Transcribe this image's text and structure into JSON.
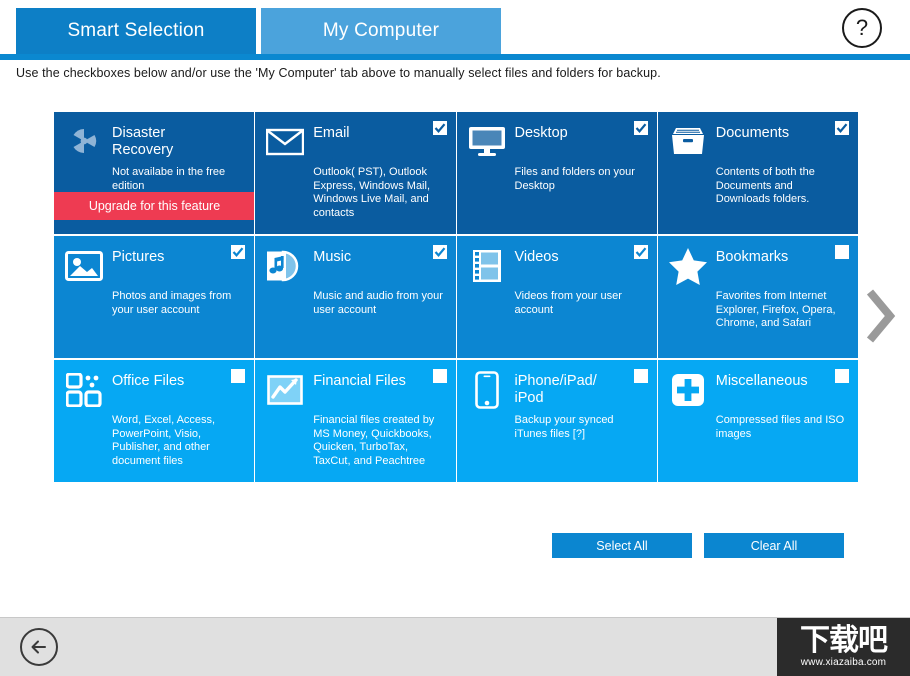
{
  "tabs": [
    {
      "label": "Smart Selection",
      "active": true
    },
    {
      "label": "My Computer",
      "active": false
    }
  ],
  "help": {
    "icon": "question-mark-icon",
    "label": "?"
  },
  "instruction": "Use the checkboxes below and/or use the 'My Computer' tab above to manually select files and folders for backup.",
  "colors": {
    "tab_active": "#0d7fc6",
    "tab_inactive": "#4ba3dc",
    "underline": "#0b88d0",
    "row1_tile": "#0a5ca0",
    "row2_tile": "#0c86d2",
    "row3_tile": "#06a8f3",
    "upgrade_banner": "#ee3b52",
    "button": "#0b86d0",
    "footer": "#e0e0e0",
    "watermark_bg": "#2b2b2b"
  },
  "grid": {
    "rows": [
      {
        "tiles": [
          {
            "title": "Disaster Recovery",
            "desc": "Not availabe in the free edition",
            "icon": "radiation-icon",
            "checkbox": "none",
            "banner": "Upgrade for this feature"
          },
          {
            "title": "Email",
            "desc": "Outlook( PST), Outlook Express, Windows Mail, Windows Live Mail, and contacts",
            "icon": "envelope-icon",
            "checkbox": "checked"
          },
          {
            "title": "Desktop",
            "desc": "Files and folders on your Desktop",
            "icon": "monitor-icon",
            "checkbox": "checked"
          },
          {
            "title": "Documents",
            "desc": "Contents of both the Documents and Downloads folders.",
            "icon": "file-box-icon",
            "checkbox": "checked"
          }
        ]
      },
      {
        "tiles": [
          {
            "title": "Pictures",
            "desc": "Photos and images from your user account",
            "icon": "picture-icon",
            "checkbox": "checked"
          },
          {
            "title": "Music",
            "desc": "Music and audio from your user account",
            "icon": "music-note-icon",
            "checkbox": "checked"
          },
          {
            "title": "Videos",
            "desc": "Videos from your user account",
            "icon": "film-strip-icon",
            "checkbox": "checked"
          },
          {
            "title": "Bookmarks",
            "desc": "Favorites from Internet Explorer, Firefox, Opera, Chrome, and Safari",
            "icon": "star-icon",
            "checkbox": "unchecked"
          }
        ]
      },
      {
        "tiles": [
          {
            "title": "Office Files",
            "desc": "Word, Excel, Access, PowerPoint, Visio, Publisher, and other document files",
            "icon": "office-icon",
            "checkbox": "unchecked"
          },
          {
            "title": "Financial Files",
            "desc": "Financial files created by MS Money, Quickbooks, Quicken, TurboTax, TaxCut, and Peachtree",
            "icon": "chart-line-icon",
            "checkbox": "unchecked"
          },
          {
            "title": "iPhone/iPad/ iPod",
            "desc": "Backup your synced iTunes files [?]",
            "icon": "smartphone-icon",
            "checkbox": "unchecked"
          },
          {
            "title": "Miscellaneous",
            "desc": "Compressed files and ISO images",
            "icon": "plus-box-icon",
            "checkbox": "unchecked"
          }
        ]
      }
    ]
  },
  "next_page": {
    "icon": "chevron-right-icon"
  },
  "actions": {
    "select_all": "Select All",
    "clear_all": "Clear All"
  },
  "footer": {
    "back_icon": "arrow-left-circle-icon",
    "watermark_cn": "下载吧",
    "watermark_url": "www.xiazaiba.com"
  }
}
